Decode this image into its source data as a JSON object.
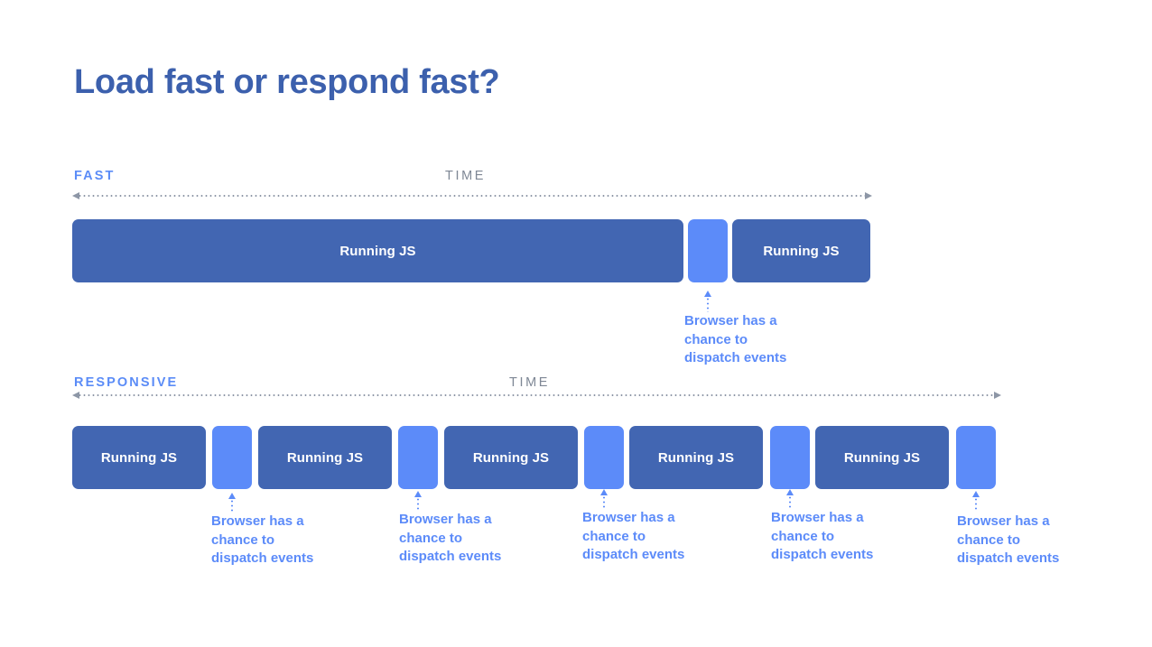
{
  "slide": {
    "title": "Load fast or respond fast?",
    "background_color": "#ffffff",
    "title_color": "#3c60ad",
    "busy_color": "#4266b2",
    "idle_color": "#5c8bf9",
    "accent_color": "#5b8cf7",
    "axis_color": "#8d96a6"
  },
  "rows": [
    {
      "label": "FAST",
      "time_label": "TIME",
      "blocks": [
        {
          "kind": "busy",
          "label": "Running JS"
        },
        {
          "kind": "idle",
          "label": ""
        },
        {
          "kind": "busy",
          "label": "Running JS"
        }
      ],
      "callouts": [
        {
          "text": "Browser has a\nchance to\ndispatch events"
        }
      ]
    },
    {
      "label": "RESPONSIVE",
      "time_label": "TIME",
      "blocks": [
        {
          "kind": "busy",
          "label": "Running JS"
        },
        {
          "kind": "idle",
          "label": ""
        },
        {
          "kind": "busy",
          "label": "Running JS"
        },
        {
          "kind": "idle",
          "label": ""
        },
        {
          "kind": "busy",
          "label": "Running JS"
        },
        {
          "kind": "idle",
          "label": ""
        },
        {
          "kind": "busy",
          "label": "Running JS"
        },
        {
          "kind": "idle",
          "label": ""
        },
        {
          "kind": "busy",
          "label": "Running JS"
        },
        {
          "kind": "idle",
          "label": ""
        }
      ],
      "callouts": [
        {
          "text": "Browser has a\nchance to\ndispatch events"
        },
        {
          "text": "Browser has a\nchance to\ndispatch events"
        },
        {
          "text": "Browser has a\nchance to\ndispatch events"
        },
        {
          "text": "Browser has a\nchance to\ndispatch events"
        },
        {
          "text": "Browser has a\nchance to\ndispatch events"
        }
      ]
    }
  ]
}
